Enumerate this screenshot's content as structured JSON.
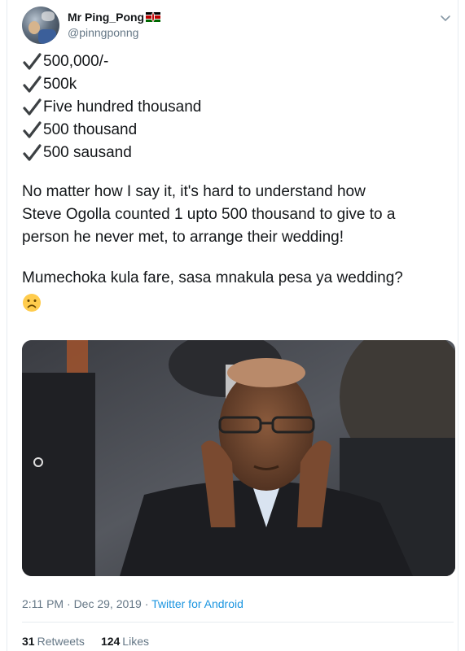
{
  "author": {
    "display_name": "Mr Ping_Pong",
    "handle": "@pinngponng",
    "flag_icon": "kenya-flag-icon"
  },
  "tweet": {
    "checklist": [
      "500,000/-",
      "500k",
      "Five hundred thousand",
      "500 thousand",
      "500 sausand"
    ],
    "paragraph1_lines": [
      "No matter how I say it, it's hard to understand how",
      "Steve Ogolla counted 1 upto 500 thousand to give to a",
      "person he never met, to arrange their wedding!"
    ],
    "paragraph2": "Mumechoka kula fare, sasa mnakula pesa ya wedding?",
    "emoji": "frowning-face"
  },
  "meta": {
    "time": "2:11 PM",
    "separator": " · ",
    "date": "Dec 29, 2019",
    "source": "Twitter for Android"
  },
  "stats": {
    "retweets_count": "31",
    "retweets_label": "Retweets",
    "likes_count": "124",
    "likes_label": "Likes"
  },
  "colors": {
    "text": "#14171a",
    "secondary": "#657786",
    "link": "#1b95e0"
  }
}
